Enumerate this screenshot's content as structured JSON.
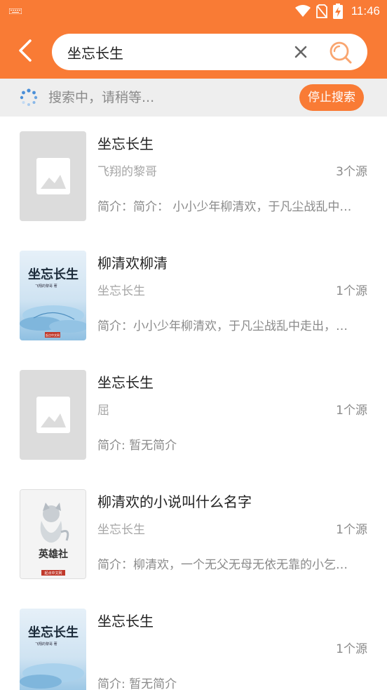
{
  "status_bar": {
    "time": "11:46"
  },
  "search": {
    "query": "坐忘长生",
    "placeholder": ""
  },
  "searching": {
    "status_text": "搜索中，请稍等...",
    "stop_label": "停止搜索"
  },
  "results": [
    {
      "title": "坐忘长生",
      "author": "飞翔的黎哥",
      "sources": "3个源",
      "intro": "简介：简介： 小小少年柳清欢，于凡尘战乱中…",
      "cover": "placeholder"
    },
    {
      "title": "柳清欢柳清",
      "author": "坐忘长生",
      "sources": "1个源",
      "intro": "简介：小小少年柳清欢，于凡尘战乱中走出，…",
      "cover": "art-blue",
      "cover_title": "坐忘长生",
      "cover_sub": "飞翔的黎哥 著",
      "cover_badge": "起点中文网"
    },
    {
      "title": "坐忘长生",
      "author": "屈",
      "sources": "1个源",
      "intro": "简介: 暂无简介",
      "cover": "placeholder"
    },
    {
      "title": "柳清欢的小说叫什么名字",
      "author": "坐忘长生",
      "sources": "1个源",
      "intro": "简介：柳清欢，一个无父无母无依无靠的小乞…",
      "cover": "art-hero",
      "cover_title": "英雄社",
      "cover_badge": "起点中文网"
    },
    {
      "title": "坐忘长生",
      "author": "",
      "sources": "1个源",
      "intro": "简介: 暂无简介",
      "cover": "art-blue",
      "cover_title": "坐忘长生",
      "cover_sub": "飞翔的黎哥 著"
    }
  ],
  "colors": {
    "accent": "#f97b35",
    "subbar": "#eeeeee",
    "placeholder": "#dcdcdc"
  }
}
